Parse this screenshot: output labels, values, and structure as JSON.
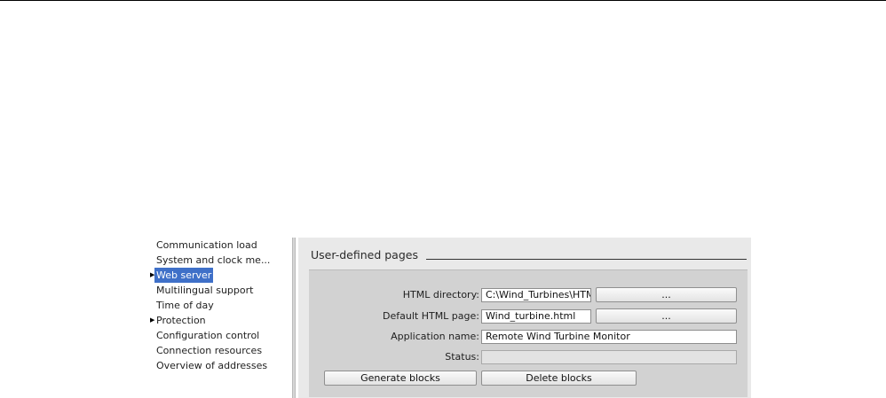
{
  "navigation": {
    "items": [
      {
        "label": "Communication load",
        "expandable": false,
        "selected": false
      },
      {
        "label": "System and clock me...",
        "expandable": false,
        "selected": false
      },
      {
        "label": "Web server",
        "expandable": true,
        "selected": true
      },
      {
        "label": "Multilingual support",
        "expandable": false,
        "selected": false
      },
      {
        "label": "Time of day",
        "expandable": false,
        "selected": false
      },
      {
        "label": "Protection",
        "expandable": true,
        "selected": false
      },
      {
        "label": "Configuration control",
        "expandable": false,
        "selected": false
      },
      {
        "label": "Connection resources",
        "expandable": false,
        "selected": false
      },
      {
        "label": "Overview of addresses",
        "expandable": false,
        "selected": false
      }
    ]
  },
  "section": {
    "title": "User-defined pages"
  },
  "form": {
    "html_directory": {
      "label": "HTML directory:",
      "value": "C:\\Wind_Turbines\\HTM",
      "browse_label": "..."
    },
    "default_html_page": {
      "label": "Default HTML page:",
      "value": "Wind_turbine.html",
      "browse_label": "..."
    },
    "application_name": {
      "label": "Application name:",
      "value": "Remote Wind Turbine Monitor"
    },
    "status": {
      "label": "Status:",
      "value": ""
    }
  },
  "actions": {
    "generate_label": "Generate blocks",
    "delete_label": "Delete blocks"
  },
  "colors": {
    "selection": "#3f70c8",
    "panel_background": "#e9e9e9",
    "form_background": "#d2d2d2"
  }
}
